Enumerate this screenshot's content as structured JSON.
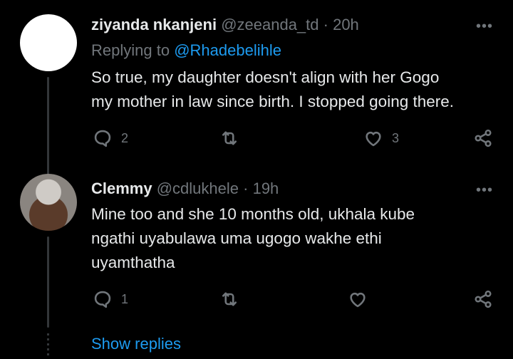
{
  "tweets": [
    {
      "name": "ziyanda nkanjeni",
      "handle": "@zeeanda_td",
      "time": "20h",
      "replying_label": "Replying to",
      "replying_handle": "@Rhadebelihle",
      "lines": [
        "So true, my daughter doesn't align with her Gogo",
        "my mother in law since birth. I stopped going there."
      ],
      "reply_count": "2",
      "like_count": "3"
    },
    {
      "name": "Clemmy",
      "handle": "@cdlukhele",
      "time": "19h",
      "lines": [
        "Mine too and she 10 months old, ukhala kube",
        "ngathi uyabulawa uma ugogo wakhe ethi",
        "uyamthatha"
      ],
      "reply_count": "1",
      "like_count": ""
    }
  ],
  "more_glyph": "•••",
  "separator": " · ",
  "show_replies": "Show replies",
  "icons": [
    "reply-icon",
    "retweet-icon",
    "like-icon",
    "share-icon",
    "more-icon"
  ],
  "colors": {
    "accent": "#1d9bf0",
    "muted": "#71767b",
    "text": "#e7e9ea",
    "background": "#000000"
  }
}
